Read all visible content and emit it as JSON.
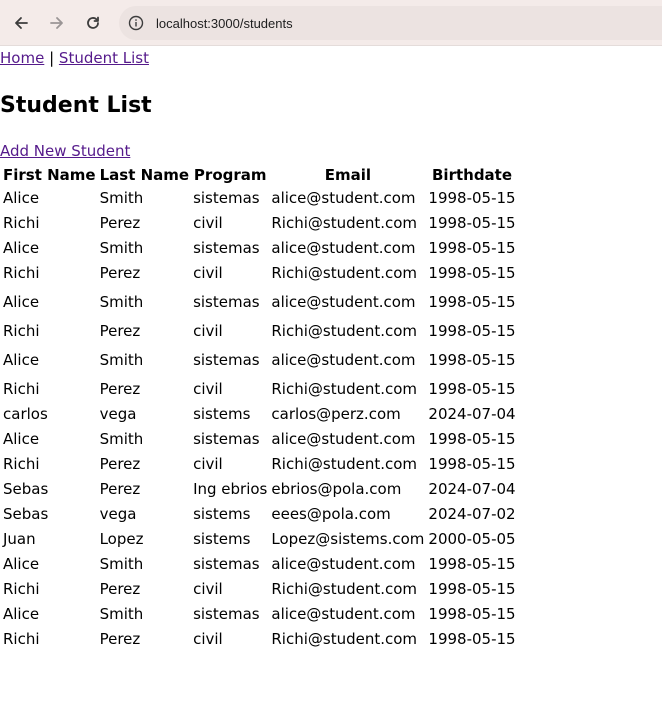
{
  "browser": {
    "url": "localhost:3000/students"
  },
  "nav": {
    "home": "Home",
    "separator": "|",
    "student_list": "Student List"
  },
  "page": {
    "title": "Student List",
    "add_link": "Add New Student"
  },
  "table": {
    "headers": [
      "First Name",
      "Last Name",
      "Program",
      "Email",
      "Birthdate"
    ],
    "rows": [
      [
        "Alice",
        "Smith",
        "sistemas",
        "alice@student.com",
        "1998-05-15"
      ],
      [
        "Richi",
        "Perez",
        "civil",
        "Richi@student.com",
        "1998-05-15"
      ],
      [
        "Alice",
        "Smith",
        "sistemas",
        "alice@student.com",
        "1998-05-15"
      ],
      [
        "Richi",
        "Perez",
        "civil",
        "Richi@student.com",
        "1998-05-15"
      ],
      [
        "Alice",
        "Smith",
        "sistemas",
        "alice@student.com",
        "1998-05-15"
      ],
      [
        "Richi",
        "Perez",
        "civil",
        "Richi@student.com",
        "1998-05-15"
      ],
      [
        "Alice",
        "Smith",
        "sistemas",
        "alice@student.com",
        "1998-05-15"
      ],
      [
        "Richi",
        "Perez",
        "civil",
        "Richi@student.com",
        "1998-05-15"
      ],
      [
        "carlos",
        "vega",
        "sistems",
        "carlos@perz.com",
        "2024-07-04"
      ],
      [
        "Alice",
        "Smith",
        "sistemas",
        "alice@student.com",
        "1998-05-15"
      ],
      [
        "Richi",
        "Perez",
        "civil",
        "Richi@student.com",
        "1998-05-15"
      ],
      [
        "Sebas",
        "Perez",
        "Ing ebrios",
        "ebrios@pola.com",
        "2024-07-04"
      ],
      [
        "Sebas",
        "vega",
        "sistems",
        "eees@pola.com",
        "2024-07-02"
      ],
      [
        "Juan",
        "Lopez",
        "sistems",
        "Lopez@sistems.com",
        "2000-05-05"
      ],
      [
        "Alice",
        "Smith",
        "sistemas",
        "alice@student.com",
        "1998-05-15"
      ],
      [
        "Richi",
        "Perez",
        "civil",
        "Richi@student.com",
        "1998-05-15"
      ],
      [
        "Alice",
        "Smith",
        "sistemas",
        "alice@student.com",
        "1998-05-15"
      ],
      [
        "Richi",
        "Perez",
        "civil",
        "Richi@student.com",
        "1998-05-15"
      ]
    ]
  },
  "icons": {
    "back": "arrow-left-icon",
    "forward": "arrow-right-icon",
    "reload": "reload-icon",
    "info": "info-icon"
  }
}
